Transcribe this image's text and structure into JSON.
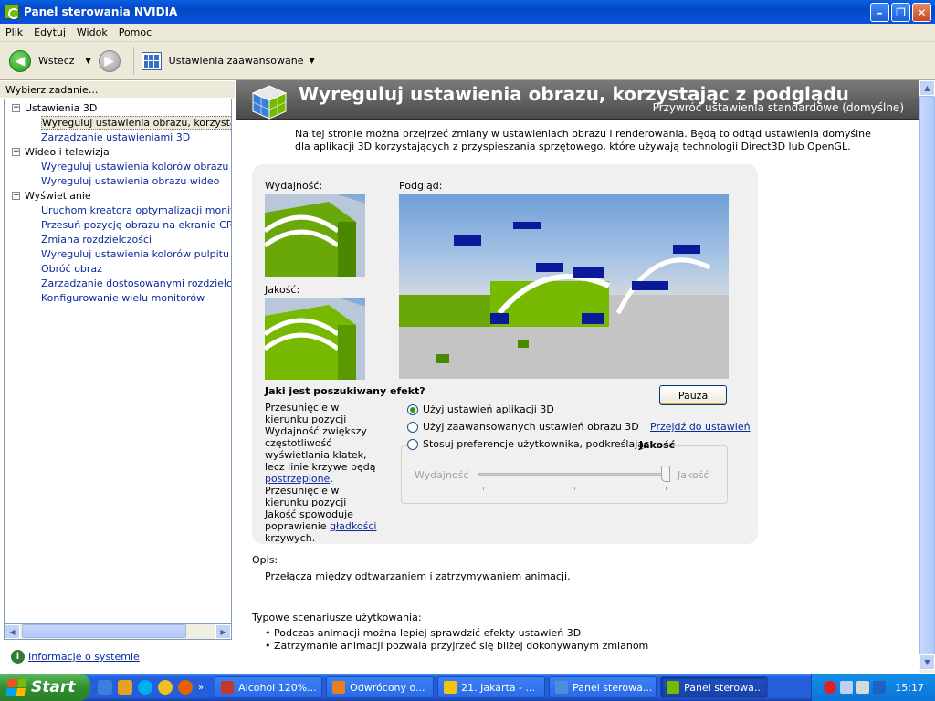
{
  "window": {
    "title": "Panel sterowania NVIDIA"
  },
  "menu": [
    "Plik",
    "Edytuj",
    "Widok",
    "Pomoc"
  ],
  "toolbar": {
    "back_label": "Wstecz",
    "advanced_label": "Ustawienia zaawansowane"
  },
  "sidebar": {
    "header": "Wybierz zadanie...",
    "sections": [
      {
        "label": "Ustawienia 3D",
        "items": [
          "Wyreguluj ustawienia obrazu, korzystając z",
          "Zarządzanie ustawieniami 3D"
        ]
      },
      {
        "label": "Wideo i telewizja",
        "items": [
          "Wyreguluj ustawienia kolorów obrazu wideo",
          "Wyreguluj ustawienia obrazu wideo"
        ]
      },
      {
        "label": "Wyświetlanie",
        "items": [
          "Uruchom kreatora optymalizacji monitorów",
          "Przesuń pozycję obrazu na ekranie CRT",
          "Zmiana rozdzielczości",
          "Wyreguluj ustawienia kolorów pulpitu",
          "Obróć obraz",
          "Zarządzanie dostosowanymi rozdzielczościa",
          "Konfigurowanie wielu monitorów"
        ]
      }
    ],
    "system_info": "Informacje o systemie"
  },
  "page": {
    "title": "Wyreguluj ustawienia obrazu, korzystając z podglądu",
    "restore": "Przywróć ustawienia standardowe (domyślne)",
    "intro": "Na tej stronie można przejrzeć zmiany  w ustawieniach obrazu i renderowania. Będą to odtąd ustawienia domyślne dla aplikacji 3D korzystających z przyspieszania sprzętowego, które używają technologii Direct3D lub OpenGL.",
    "performance_label": "Wydajność:",
    "quality_label": "Jakość:",
    "preview_label": "Podgląd:",
    "pause_button": "Pauza",
    "question": "Jaki jest poszukiwany efekt?",
    "help1_pre": "Przesunięcie w kierunku pozycji Wydajność zwiększy częstotliwość wyświetlania klatek, lecz linie krzywe będą ",
    "help1_link": "postrzępione",
    "help1_post": ".",
    "help2_pre": "Przesunięcie w kierunku pozycji Jakość spowoduje poprawienie ",
    "help2_link": "gładkości",
    "help2_post": " krzywych.",
    "options": [
      {
        "label": "Użyj ustawień aplikacji 3D",
        "checked": true
      },
      {
        "label": "Użyj zaawansowanych ustawień obrazu 3D",
        "checked": false
      },
      {
        "label": "Stosuj preferencje użytkownika, podkreślając:",
        "checked": false
      }
    ],
    "goto_link": "Przejdź do ustawień",
    "emphasis_value": "Jakość",
    "slider": {
      "min_label": "Wydajność",
      "max_label": "Jakość",
      "value_fraction": 1.0
    },
    "description_heading": "Opis:",
    "description": "Przełącza między odtwarzaniem i zatrzymywaniem animacji.",
    "usage_heading": "Typowe scenariusze użytkowania:",
    "usage": [
      "Podczas animacji można lepiej sprawdzić efekty ustawień 3D",
      "Zatrzymanie animacji pozwala przyjrzeć się bliżej dokonywanym zmianom"
    ]
  },
  "taskbar": {
    "start": "Start",
    "tasks": [
      {
        "label": "Alcohol 120%...",
        "color": "#c0392b"
      },
      {
        "label": "Odwrócony o...",
        "color": "#e67e22"
      },
      {
        "label": "21. Jakarta - ...",
        "color": "#f1c40f"
      },
      {
        "label": "Panel sterowa...",
        "color": "#4a90d9"
      },
      {
        "label": "Panel sterowa...",
        "color": "#76b900"
      }
    ],
    "clock": "15:17"
  },
  "colors": {
    "accent": "#0b2a9c",
    "nvidia_green": "#76b900",
    "banner": "#5a5a5a"
  }
}
